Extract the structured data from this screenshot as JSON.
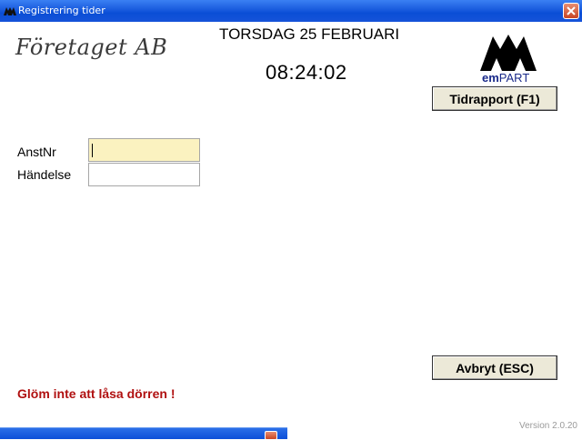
{
  "window": {
    "title": "Registrering tider",
    "icon": "empart-logo-icon",
    "close_icon": "close-icon"
  },
  "header": {
    "company": "Företaget AB",
    "date": "TORSDAG 25 FEBRUARI",
    "time": "08:24:02",
    "brand": {
      "prefix": "em",
      "suffix": "PART"
    }
  },
  "buttons": {
    "report": "Tidrapport (F1)",
    "cancel": "Avbryt (ESC)"
  },
  "form": {
    "employee_label": "AnstNr",
    "employee_value": "",
    "event_label": "Händelse",
    "event_value": ""
  },
  "footer": {
    "warning": "Glöm inte att låsa dörren !",
    "version": "Version 2.0.20"
  },
  "colors": {
    "titlebar": "#0a4ed6",
    "warning": "#b01010",
    "active_field": "#fbf2c0",
    "brand": "#1a2a8a"
  }
}
